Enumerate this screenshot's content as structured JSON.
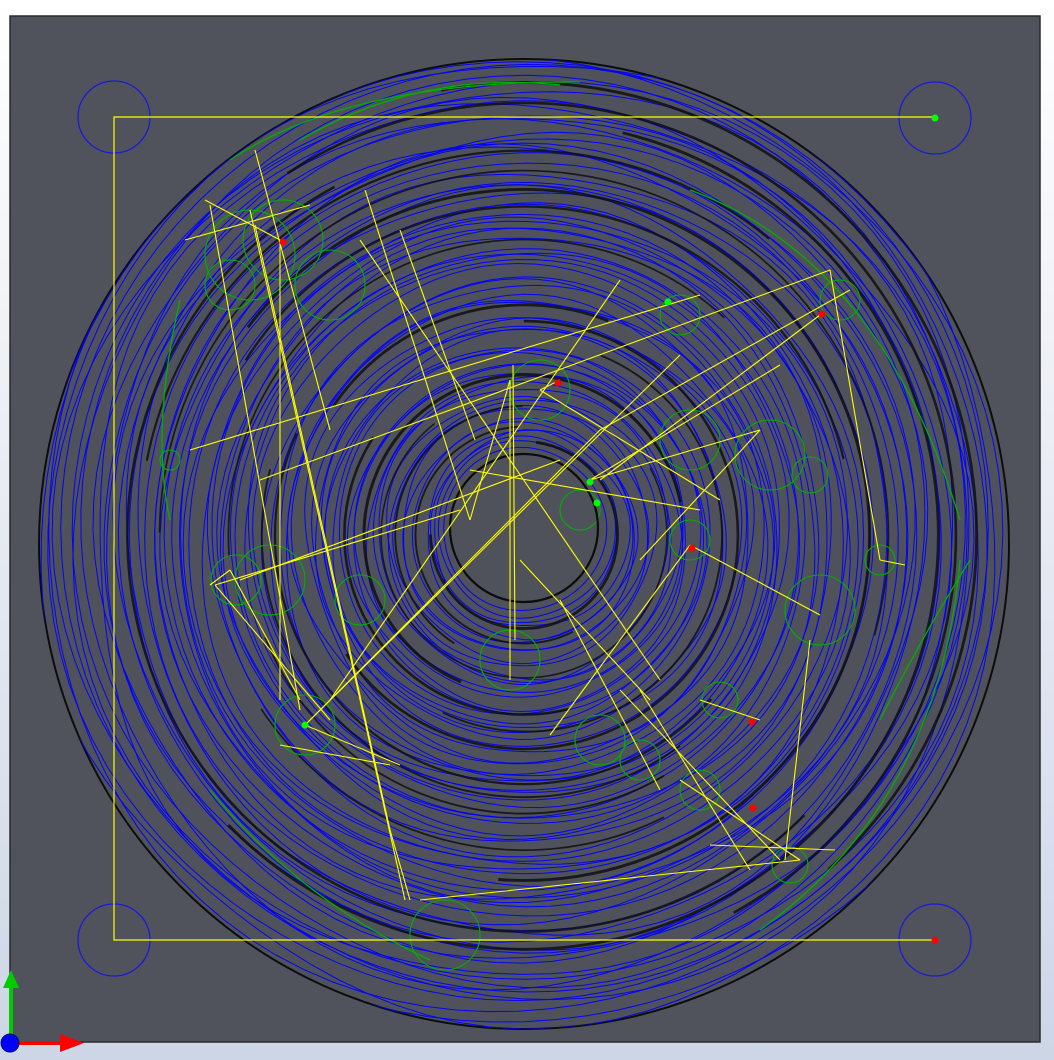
{
  "viewport": {
    "background": "#ffffff",
    "plate_color": "#50535b",
    "disk_outline_color": "#101010",
    "toolpath_color": "#0000ff",
    "lead_color": "#00b000",
    "rapid_color": "#ffff00",
    "marker_green": "#00ff00",
    "marker_red": "#ff0000"
  },
  "triad": {
    "x_axis_color": "#ff0000",
    "y_axis_color": "#00cc00",
    "z_axis_color": "#0000ff"
  }
}
